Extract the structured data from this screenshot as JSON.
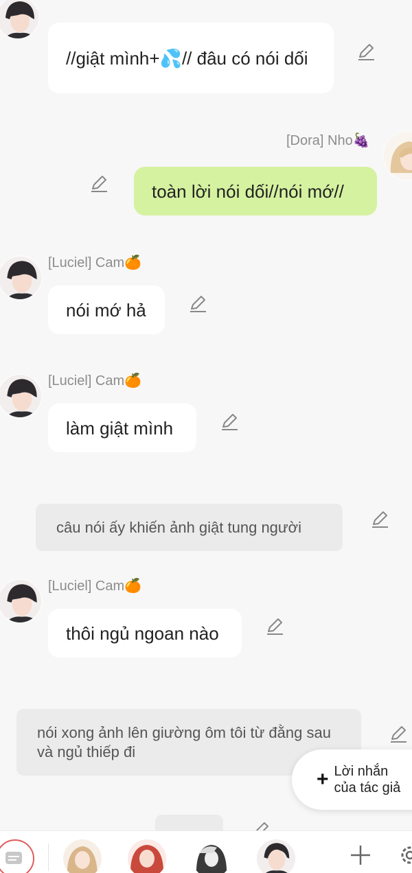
{
  "chat": {
    "m1": {
      "text": "//giật mình+💦// đâu có nói dối"
    },
    "m2": {
      "sender": "[Dora] Nho🍇",
      "text": "toàn lời nói dối//nói mớ//"
    },
    "m3": {
      "sender": "[Luciel] Cam🍊",
      "text": "nói mớ hả"
    },
    "m4": {
      "sender": "[Luciel] Cam🍊",
      "text": "làm giật mình"
    },
    "n1": {
      "text": "câu nói ấy khiến ảnh giật tung người"
    },
    "m5": {
      "sender": "[Luciel] Cam🍊",
      "text": "thôi ngủ ngoan nào"
    },
    "n2": {
      "text": "nói xong ảnh lên giường ôm tôi từ đằng sau và ngủ thiếp đi"
    }
  },
  "fab": {
    "label_line1": "Lời nhắn",
    "label_line2": "của tác giả"
  },
  "colors": {
    "my_bubble": "#d5f2a0",
    "other_bubble": "#ffffff",
    "narration": "#ebebeb",
    "background": "#f7f7f7"
  },
  "icons": [
    "edit-pencil-icon",
    "plus-icon",
    "settings-gear-icon",
    "chat-list-icon"
  ]
}
